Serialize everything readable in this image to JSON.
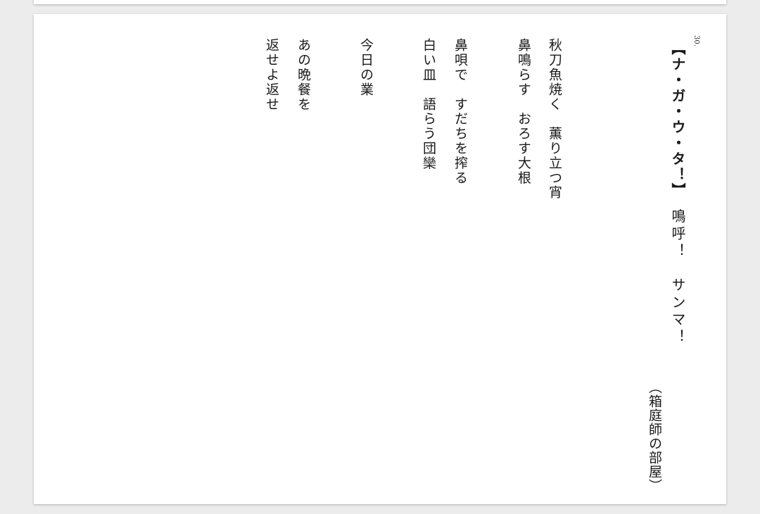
{
  "document": {
    "number": "30.",
    "title_bracketed": "【ナ・ガ・ウ・タ！】",
    "title_rest": "　鳴呼！　サンマ！",
    "location": "（箱庭師の部屋）",
    "poem_lines": [
      "秋刀魚焼く　薫り立つ宵",
      "鼻鳴らす　おろす大根",
      "鼻唄で　すだちを搾る",
      "白い皿　語らう団欒",
      "今日の業",
      "あの晩餐を",
      "返せよ返せ"
    ]
  }
}
